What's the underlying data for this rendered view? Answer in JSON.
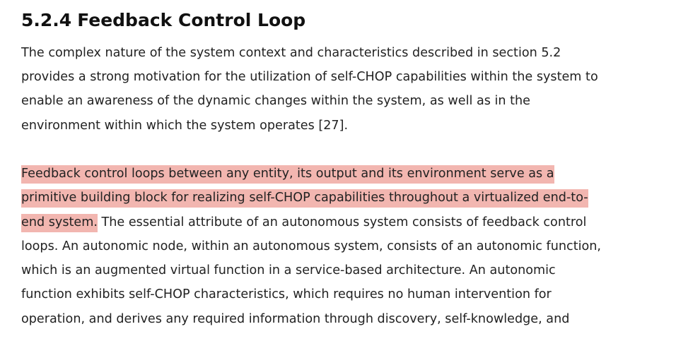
{
  "section": {
    "number": "5.2.4",
    "title": "Feedback Control Loop"
  },
  "paragraph1": {
    "lines": [
      "The complex nature of the system context and characteristics described in section 5.2",
      "provides a strong motivation for the utilization of self-CHOP capabilities within the system to",
      "enable an awareness of the dynamic changes within the system, as well as in the",
      "environment within which the system operates [27]."
    ]
  },
  "paragraph2": {
    "highlight_color": "#f2b6b0",
    "line1_highlight": "Feedback control loops between any entity, its output and its environment serve as a",
    "line2_highlight": "primitive building block for realizing self-CHOP capabilities throughout a virtualized end-to-",
    "line3_highlight": "end system.",
    "line3_rest": " The essential attribute of an autonomous system consists of feedback control",
    "lines_rest": [
      "loops. An autonomic node, within an autonomous system, consists of an autonomic function,",
      "which is an augmented virtual function in a service-based architecture. An autonomic",
      "function exhibits self-CHOP characteristics, which requires no human intervention for",
      "operation, and derives any required information through discovery, self-knowledge, and"
    ]
  }
}
